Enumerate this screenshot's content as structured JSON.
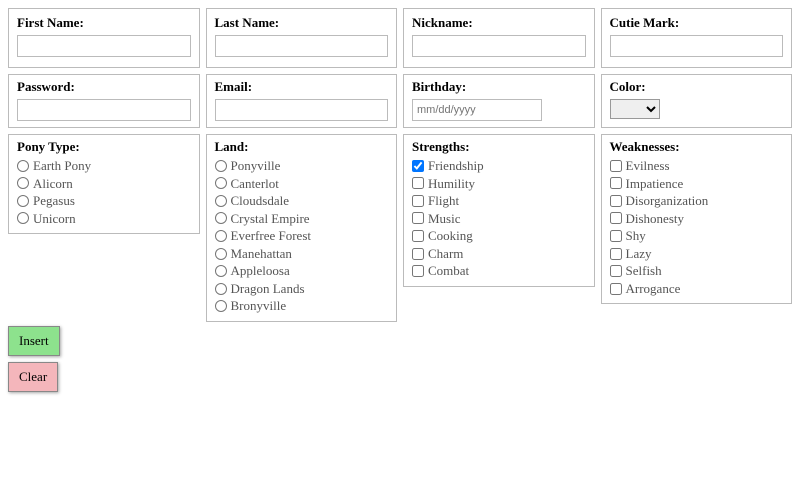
{
  "row1": {
    "first_name": {
      "label": "First Name:",
      "value": ""
    },
    "last_name": {
      "label": "Last Name:",
      "value": ""
    },
    "nickname": {
      "label": "Nickname:",
      "value": ""
    },
    "cutie_mark": {
      "label": "Cutie Mark:",
      "value": ""
    }
  },
  "row2": {
    "password": {
      "label": "Password:",
      "value": ""
    },
    "email": {
      "label": "Email:",
      "value": ""
    },
    "birthday": {
      "label": "Birthday:",
      "placeholder": "mm/dd/yyyy",
      "value": ""
    },
    "color": {
      "label": "Color:",
      "value": ""
    }
  },
  "pony_type": {
    "label": "Pony Type:",
    "options": [
      "Earth Pony",
      "Alicorn",
      "Pegasus",
      "Unicorn"
    ],
    "selected": null
  },
  "land": {
    "label": "Land:",
    "options": [
      "Ponyville",
      "Canterlot",
      "Cloudsdale",
      "Crystal Empire",
      "Everfree Forest",
      "Manehattan",
      "Appleloosa",
      "Dragon Lands",
      "Bronyville"
    ],
    "selected": null
  },
  "strengths": {
    "label": "Strengths:",
    "options": [
      "Friendship",
      "Humility",
      "Flight",
      "Music",
      "Cooking",
      "Charm",
      "Combat"
    ],
    "checked": [
      "Friendship"
    ]
  },
  "weaknesses": {
    "label": "Weaknesses:",
    "options": [
      "Evilness",
      "Impatience",
      "Disorganization",
      "Dishonesty",
      "Shy",
      "Lazy",
      "Selfish",
      "Arrogance"
    ],
    "checked": []
  },
  "buttons": {
    "insert": "Insert",
    "clear": "Clear"
  }
}
